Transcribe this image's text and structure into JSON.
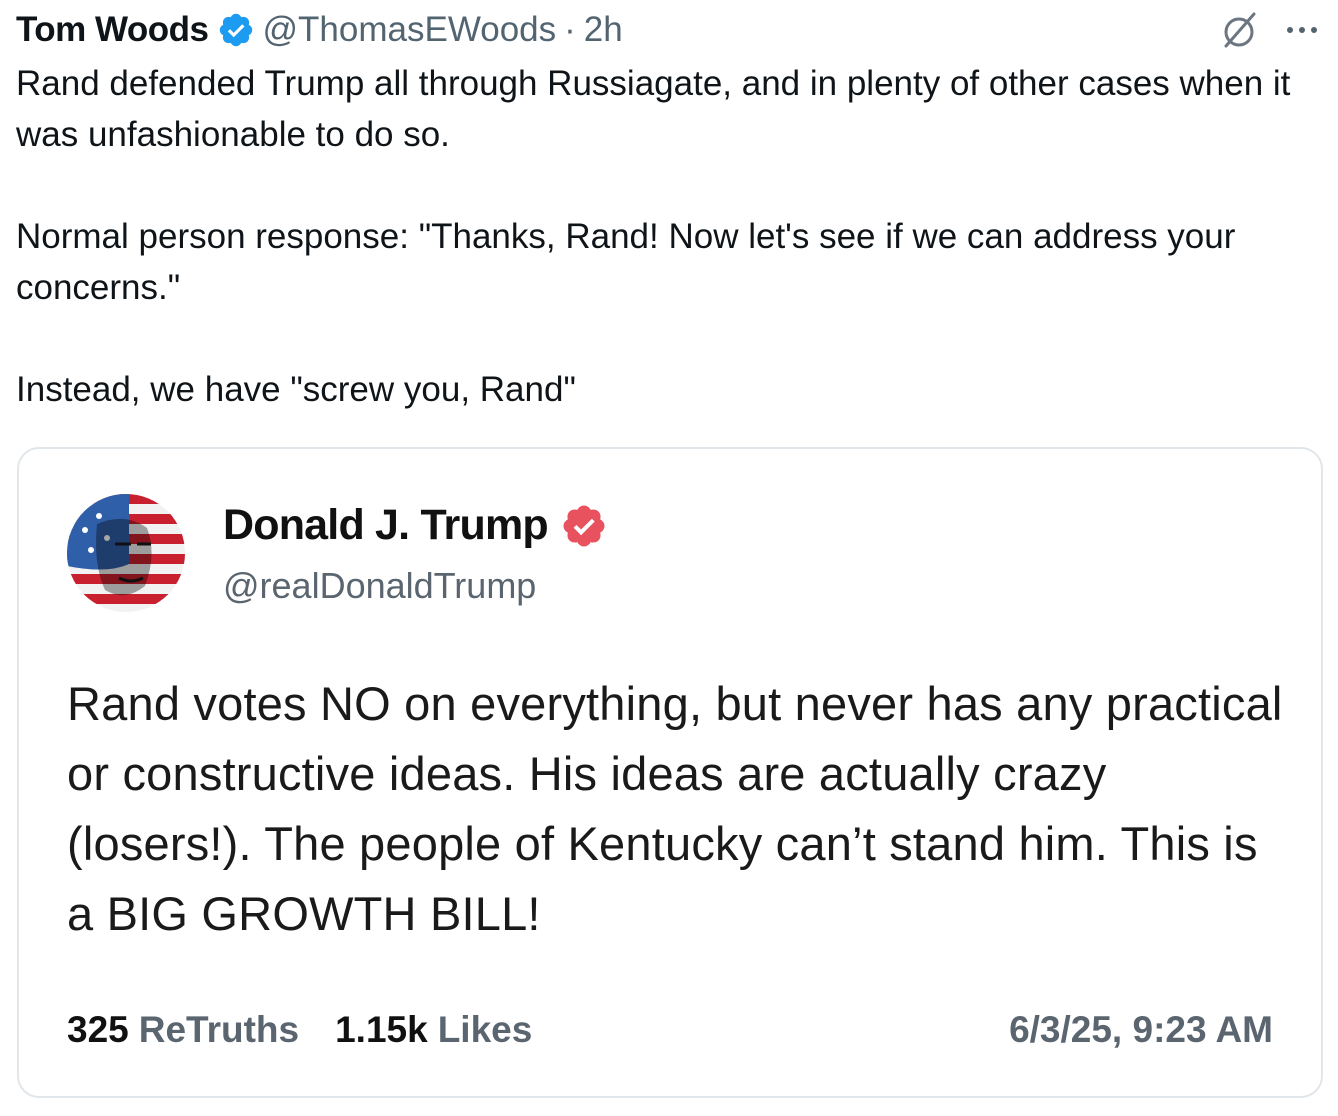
{
  "post": {
    "author_name": "Tom Woods",
    "handle": "@ThomasEWoods",
    "separator": "·",
    "time": "2h",
    "icons": {
      "verified": "verified-badge-icon",
      "grok": "grok-icon",
      "more": "more-icon"
    },
    "paragraphs": [
      "Rand defended Trump all through Russiagate, and in plenty of other cases when it was unfashionable to do so.",
      "Normal person response: \"Thanks, Rand! Now let's see if we can address your concerns.\"",
      "Instead, we have \"screw you, Rand\""
    ]
  },
  "quote": {
    "name": "Donald J. Trump",
    "handle": "@realDonaldTrump",
    "text": "Rand votes NO on everything, but never has any practical or constructive ideas. His ideas are actually crazy (losers!). The people of Kentucky can’t stand him. This is a BIG GROWTH BILL!",
    "stats": [
      {
        "value": "325",
        "label": "ReTruths"
      },
      {
        "value": "1.15k",
        "label": "Likes"
      }
    ],
    "date": "6/3/25, 9:23 AM",
    "icons": {
      "avatar": "avatar-flag-portrait",
      "verified": "verified-badge-icon"
    }
  },
  "colors": {
    "x_verified": "#1d9bf0",
    "truth_verified": "#e8525f",
    "muted_text": "#536471",
    "card_border": "#e1e6ea"
  }
}
